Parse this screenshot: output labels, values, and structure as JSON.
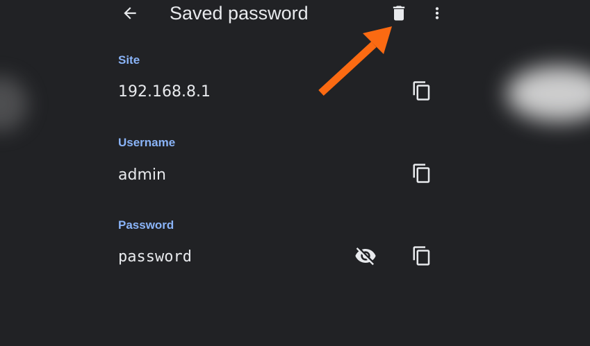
{
  "header": {
    "title": "Saved password"
  },
  "fields": {
    "site": {
      "label": "Site",
      "value": "192.168.8.1"
    },
    "username": {
      "label": "Username",
      "value": "admin"
    },
    "password": {
      "label": "Password",
      "value": "password"
    }
  },
  "colors": {
    "background": "#212225",
    "label": "#8ab4f8",
    "text": "#e8eaed",
    "annotation_arrow": "#fb6a12"
  },
  "icons": {
    "back": "arrow-left-icon",
    "delete": "trash-icon",
    "more": "more-vertical-icon",
    "copy": "copy-icon",
    "visibility": "eye-off-icon"
  }
}
